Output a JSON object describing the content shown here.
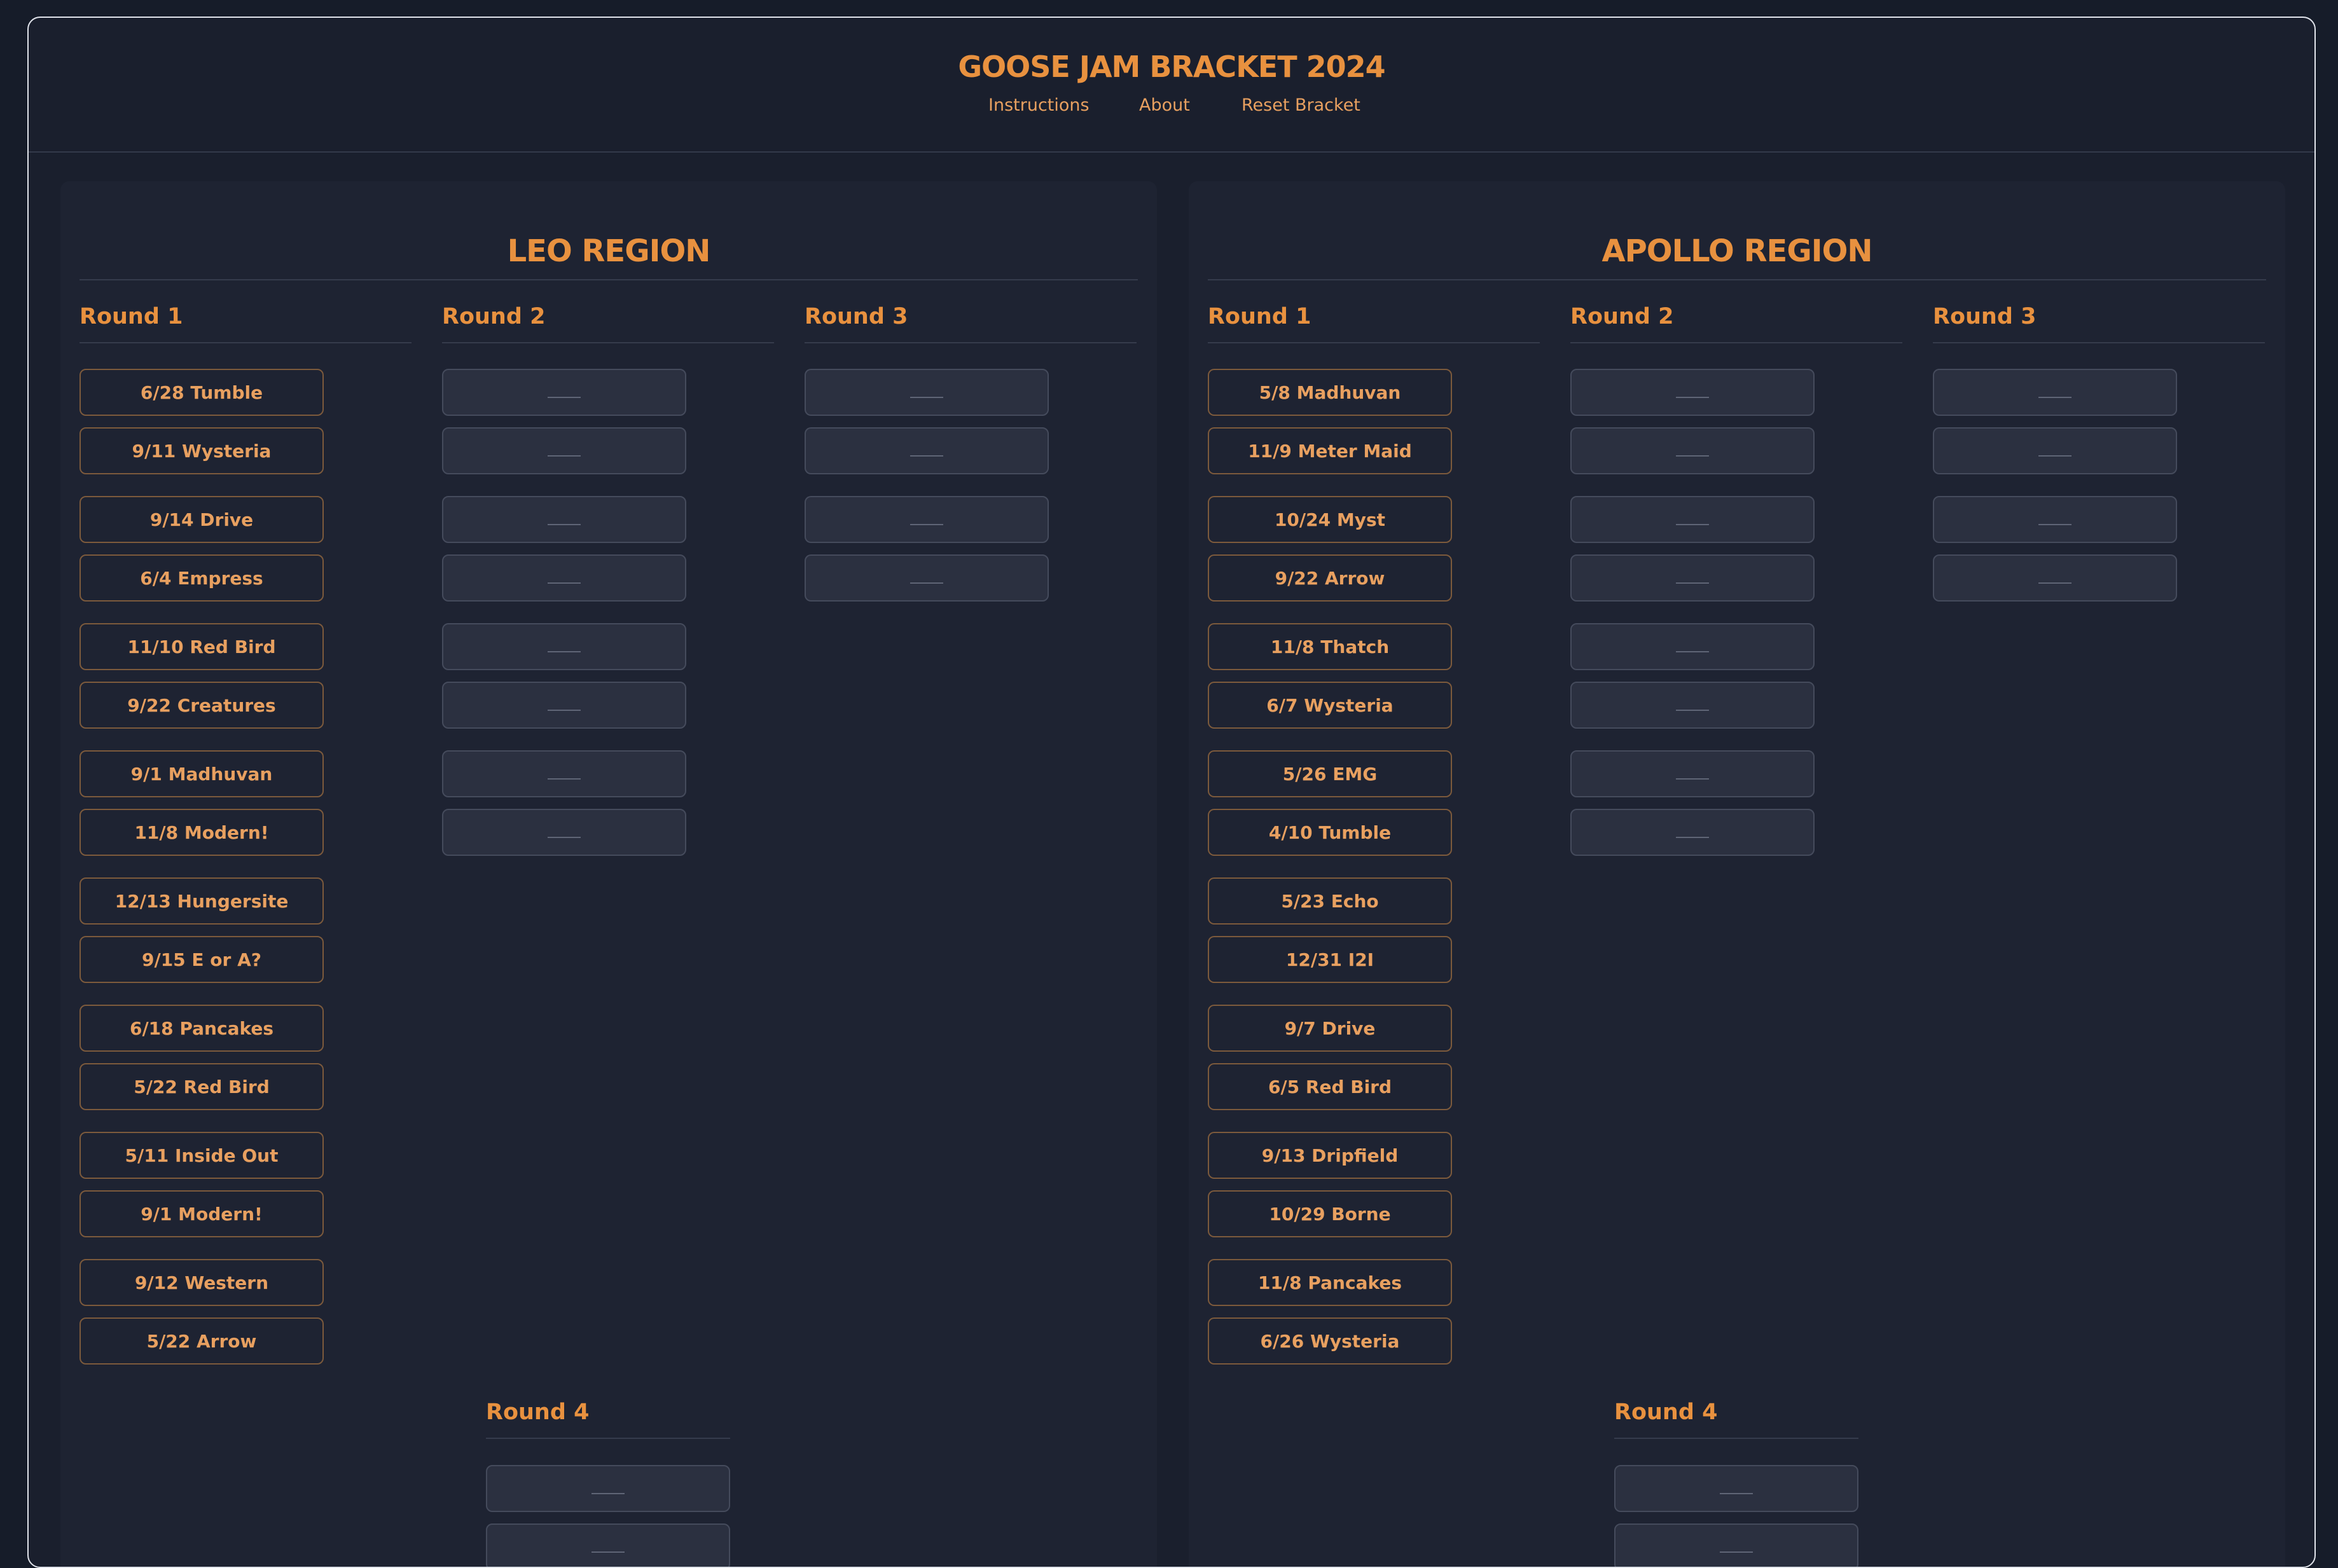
{
  "app": {
    "title": "GOOSE JAM BRACKET 2024",
    "nav": [
      "Instructions",
      "About",
      "Reset Bracket"
    ]
  },
  "regions": [
    {
      "name": "LEO REGION",
      "rounds": [
        "Round 1",
        "Round 2",
        "Round 3",
        "Round 4"
      ],
      "round1": [
        "6/28 Tumble",
        "9/11 Wysteria",
        "9/14 Drive",
        "6/4 Empress",
        "11/10 Red Bird",
        "9/22 Creatures",
        "9/1 Madhuvan",
        "11/8 Modern!",
        "12/13 Hungersite",
        "9/15 E or A?",
        "6/18 Pancakes",
        "5/22 Red Bird",
        "5/11 Inside Out",
        "9/1 Modern!",
        "9/12 Western",
        "5/22 Arrow"
      ]
    },
    {
      "name": "APOLLO REGION",
      "rounds": [
        "Round 1",
        "Round 2",
        "Round 3",
        "Round 4"
      ],
      "round1": [
        "5/8 Madhuvan",
        "11/9 Meter Maid",
        "10/24 Myst",
        "9/22 Arrow",
        "11/8 Thatch",
        "6/7 Wysteria",
        "5/26 EMG",
        "4/10 Tumble",
        "5/23 Echo",
        "12/31 I2I",
        "9/7 Drive",
        "6/5 Red Bird",
        "9/13 Dripfield",
        "10/29 Borne",
        "11/8 Pancakes",
        "6/26 Wysteria"
      ]
    }
  ],
  "colors": {
    "accent": "#e8913f",
    "background": "#161c29",
    "panel": "#1e2332",
    "empty_slot": "#2b3040"
  }
}
